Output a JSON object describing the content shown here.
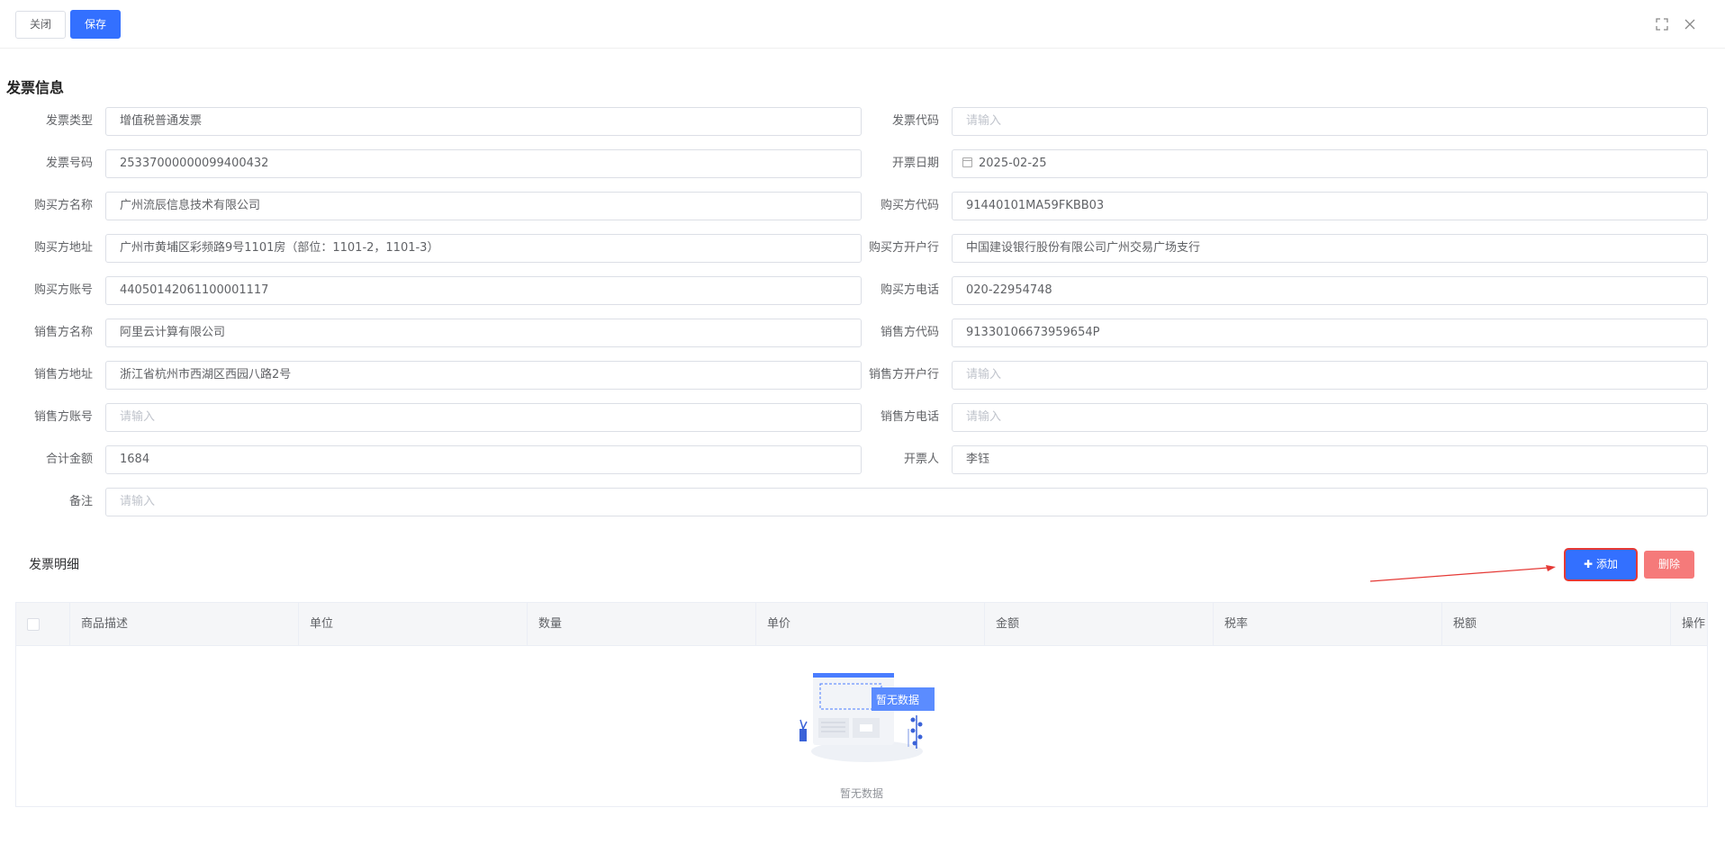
{
  "toolbar": {
    "close_label": "关闭",
    "save_label": "保存"
  },
  "window": {
    "maximize_icon": "maximize-icon",
    "close_icon": "close-icon"
  },
  "section": {
    "title": "发票信息"
  },
  "form": {
    "invoice_type": {
      "label": "发票类型",
      "value": "增值税普通发票"
    },
    "invoice_code": {
      "label": "发票代码",
      "placeholder": "请输入"
    },
    "invoice_number": {
      "label": "发票号码",
      "value": "25337000000099400432"
    },
    "issue_date": {
      "label": "开票日期",
      "value": "2025-02-25"
    },
    "buyer_name": {
      "label": "购买方名称",
      "value": "广州流辰信息技术有限公司"
    },
    "buyer_code": {
      "label": "购买方代码",
      "value": "91440101MA59FKBB03"
    },
    "buyer_address": {
      "label": "购买方地址",
      "value": "广州市黄埔区彩频路9号1101房（部位：1101-2，1101-3）"
    },
    "buyer_bank": {
      "label": "购买方开户行",
      "value": "中国建设银行股份有限公司广州交易广场支行"
    },
    "buyer_account": {
      "label": "购买方账号",
      "value": "44050142061100001117"
    },
    "buyer_phone": {
      "label": "购买方电话",
      "value": "020-22954748"
    },
    "seller_name": {
      "label": "销售方名称",
      "value": "阿里云计算有限公司"
    },
    "seller_code": {
      "label": "销售方代码",
      "value": "91330106673959654P"
    },
    "seller_address": {
      "label": "销售方地址",
      "value": "浙江省杭州市西湖区西园八路2号"
    },
    "seller_bank": {
      "label": "销售方开户行",
      "placeholder": "请输入"
    },
    "seller_account": {
      "label": "销售方账号",
      "placeholder": "请输入"
    },
    "seller_phone": {
      "label": "销售方电话",
      "placeholder": "请输入"
    },
    "total_amount": {
      "label": "合计金额",
      "value": "1684"
    },
    "issuer": {
      "label": "开票人",
      "value": "李钰"
    },
    "remark": {
      "label": "备注",
      "placeholder": "请输入"
    }
  },
  "detail": {
    "title": "发票明细",
    "add_label": "添加",
    "delete_label": "删除",
    "columns": [
      "商品描述",
      "单位",
      "数量",
      "单价",
      "金额",
      "税率",
      "税额",
      "操作"
    ],
    "empty_badge": "暂无数据",
    "empty_text": "暂无数据"
  },
  "colors": {
    "primary": "#3370ff",
    "danger": "#f56c6c",
    "highlight": "#e53935"
  }
}
